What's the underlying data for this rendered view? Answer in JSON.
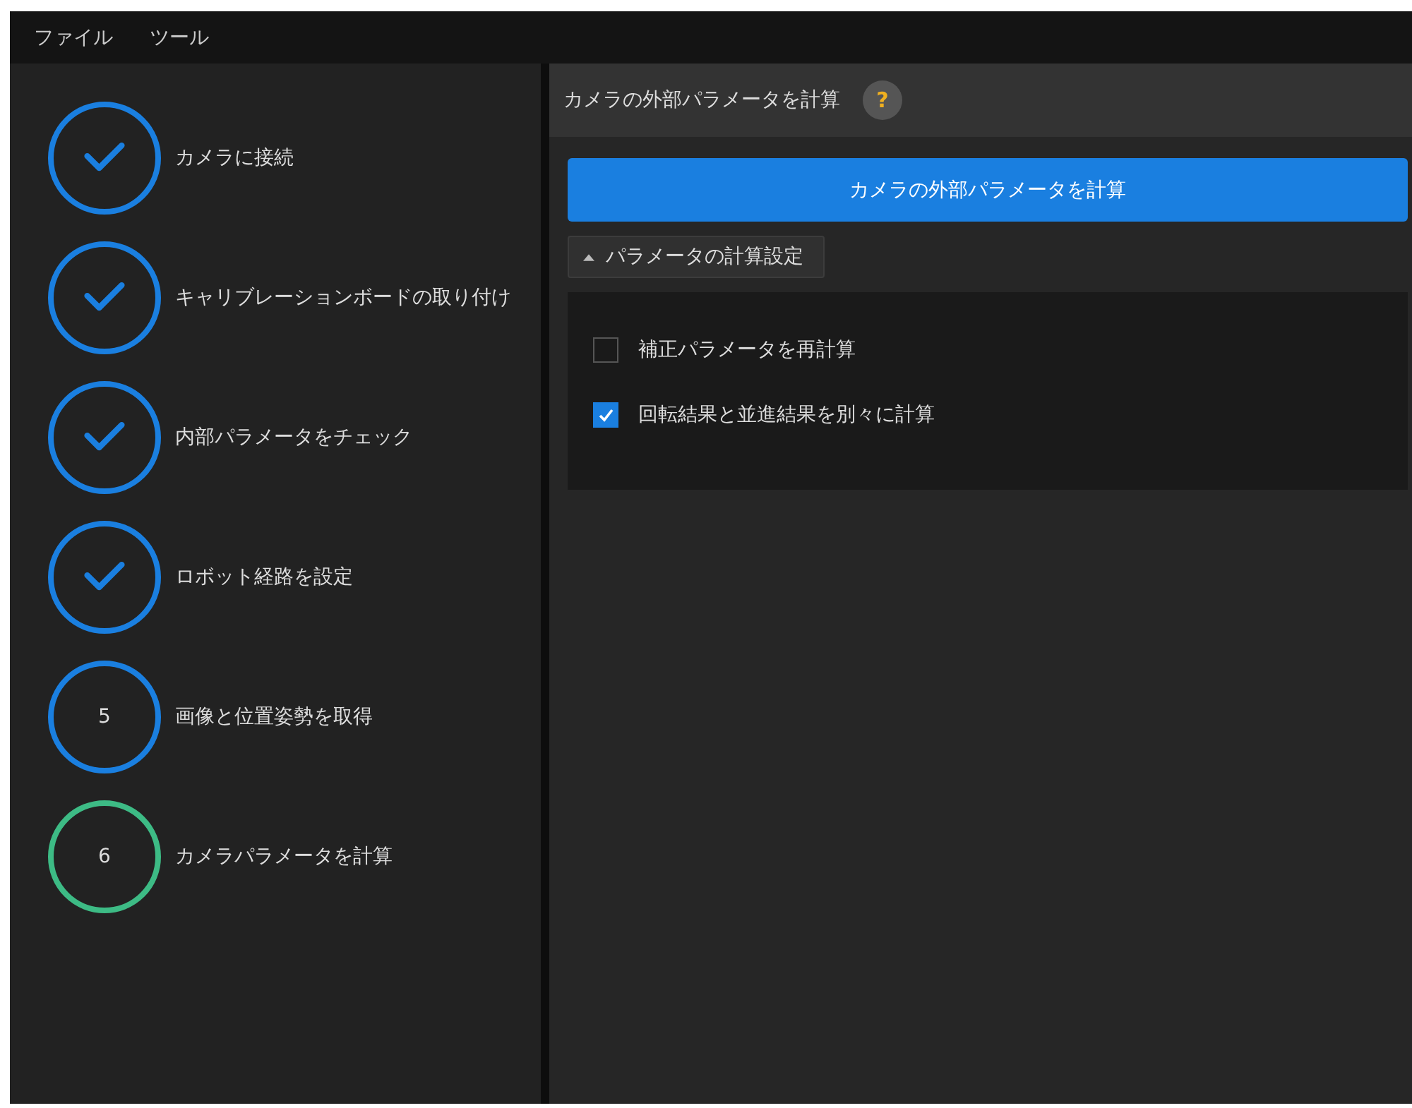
{
  "menu": [
    "ファイル",
    "ツール"
  ],
  "steps": [
    {
      "label": "カメラに接続",
      "done": true,
      "current": false
    },
    {
      "label": "キャリブレーションボードの取り付け",
      "done": true,
      "current": false
    },
    {
      "label": "内部パラメータをチェック",
      "done": true,
      "current": false
    },
    {
      "label": "ロボット経路を設定",
      "done": true,
      "current": false
    },
    {
      "label": "画像と位置姿勢を取得",
      "done": false,
      "current": false,
      "number": "5"
    },
    {
      "label": "カメラパラメータを計算",
      "done": false,
      "current": true,
      "number": "6"
    }
  ],
  "panel": {
    "title": "カメラの外部パラメータを計算",
    "help": "?",
    "action_button": "カメラの外部パラメータを計算",
    "section": {
      "label": "パラメータの計算設定",
      "expanded": true,
      "options": [
        {
          "label": "補正パラメータを再計算",
          "checked": false
        },
        {
          "label": "回転結果と並進結果を別々に計算",
          "checked": true
        }
      ]
    }
  }
}
